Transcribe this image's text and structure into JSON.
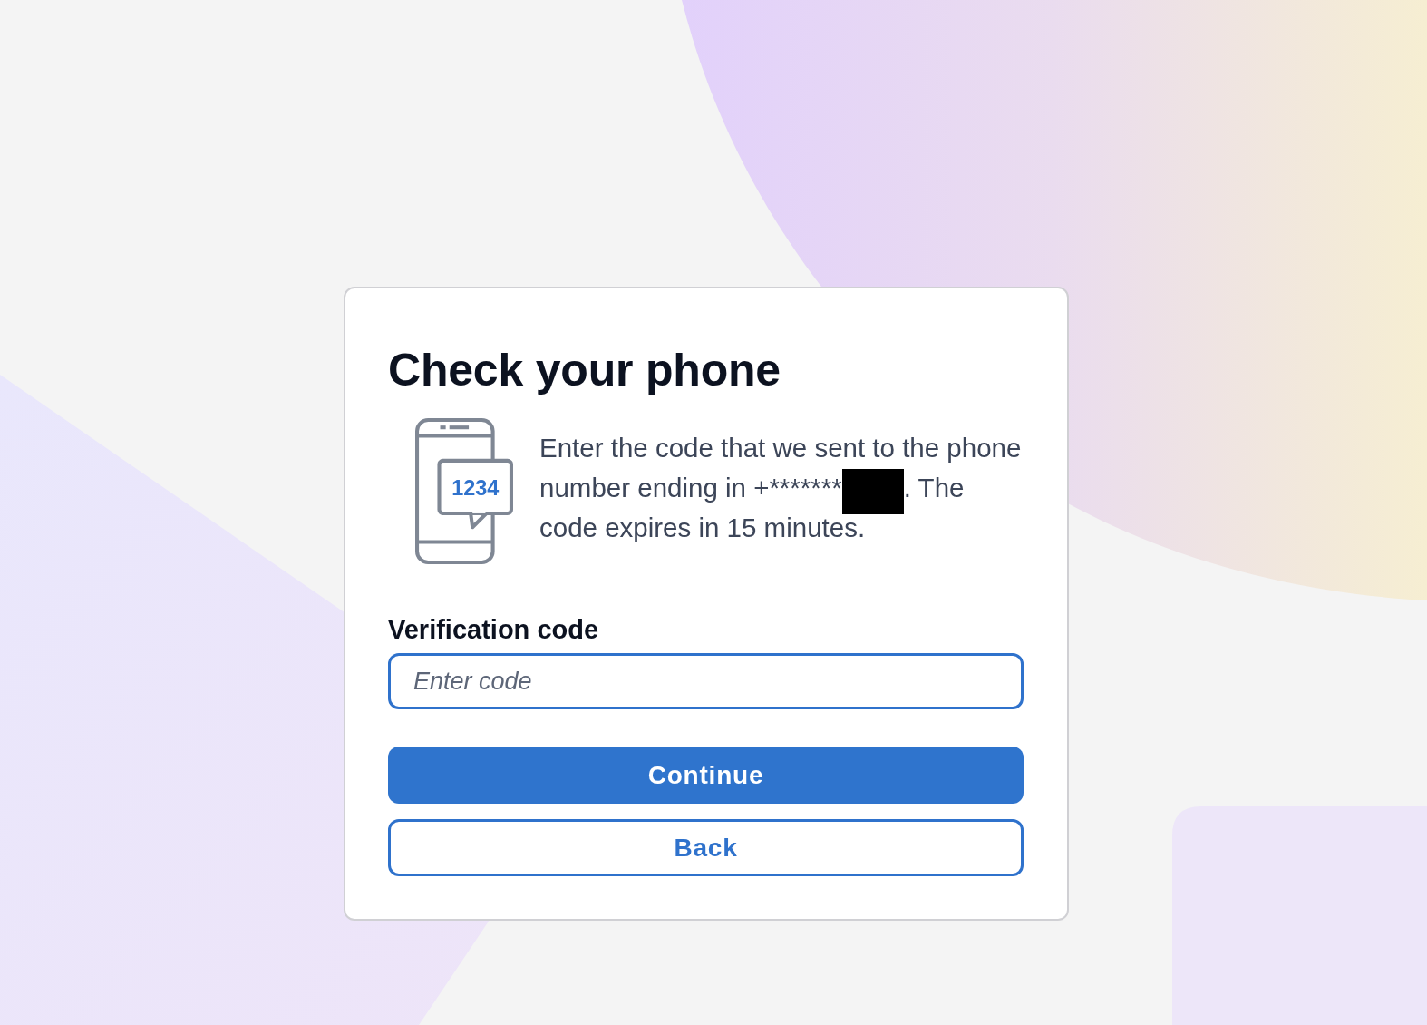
{
  "card": {
    "title": "Check your phone",
    "icon_code": "1234",
    "message_lines": [
      {
        "text": "Enter the code that we sent to the phone",
        "redacted": false
      },
      {
        "text": "number ending in +*******",
        "redacted": true,
        "text_after": ". The"
      },
      {
        "text": "code expires in 15 minutes.",
        "redacted": false
      }
    ],
    "field": {
      "label": "Verification code",
      "placeholder": "Enter code"
    },
    "buttons": [
      {
        "label": "Continue",
        "kind": "primary"
      },
      {
        "label": "Back",
        "kind": "secondary"
      }
    ]
  }
}
